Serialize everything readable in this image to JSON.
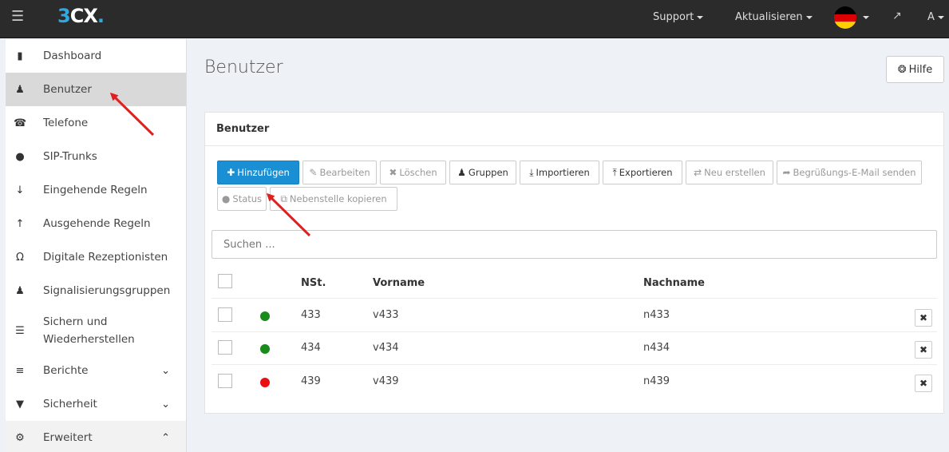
{
  "topbar": {
    "logo_prefix": "3",
    "logo_suffix": "CX",
    "logo_dot": ".",
    "support": "Support",
    "update": "Aktualisieren",
    "user": "A"
  },
  "sidebar": {
    "items": [
      {
        "label": "Dashboard",
        "icon": "bar-chart-icon"
      },
      {
        "label": "Benutzer",
        "icon": "user-icon"
      },
      {
        "label": "Telefone",
        "icon": "phone-icon"
      },
      {
        "label": "SIP-Trunks",
        "icon": "globe-icon"
      },
      {
        "label": "Eingehende Regeln",
        "icon": "arrow-down-icon"
      },
      {
        "label": "Ausgehende Regeln",
        "icon": "arrow-up-icon"
      },
      {
        "label": "Digitale Rezeptionisten",
        "icon": "headset-icon"
      },
      {
        "label": "Signalisierungsgruppen",
        "icon": "group-icon"
      },
      {
        "label": "Sichern und",
        "label2": "Wiederherstellen",
        "icon": "database-icon"
      },
      {
        "label": "Berichte",
        "icon": "list-icon"
      },
      {
        "label": "Sicherheit",
        "icon": "shield-icon"
      },
      {
        "label": "Erweitert",
        "icon": "gear-icon"
      }
    ]
  },
  "main": {
    "title": "Benutzer",
    "help": "Hilfe",
    "panel_title": "Benutzer",
    "toolbar": {
      "add": "Hinzufügen",
      "edit": "Bearbeiten",
      "delete": "Löschen",
      "groups": "Gruppen",
      "import": "Importieren",
      "export": "Exportieren",
      "regenerate": "Neu erstellen",
      "welcome": "Begrüßungs-E-Mail senden",
      "status": "Status",
      "copy": "Nebenstelle kopieren"
    },
    "search_placeholder": "Suchen ...",
    "columns": {
      "ext": "NSt.",
      "first": "Vorname",
      "last": "Nachname"
    },
    "rows": [
      {
        "ext": "433",
        "first": "v433",
        "last": "n433",
        "status_color": "#1a8a1a"
      },
      {
        "ext": "434",
        "first": "v434",
        "last": "n434",
        "status_color": "#1a8a1a"
      },
      {
        "ext": "439",
        "first": "v439",
        "last": "n439",
        "status_color": "#e81010"
      }
    ]
  },
  "colors": {
    "accent": "#1a8fd3",
    "topbar": "#2b2b2b",
    "annotation_arrow": "#e02020"
  }
}
